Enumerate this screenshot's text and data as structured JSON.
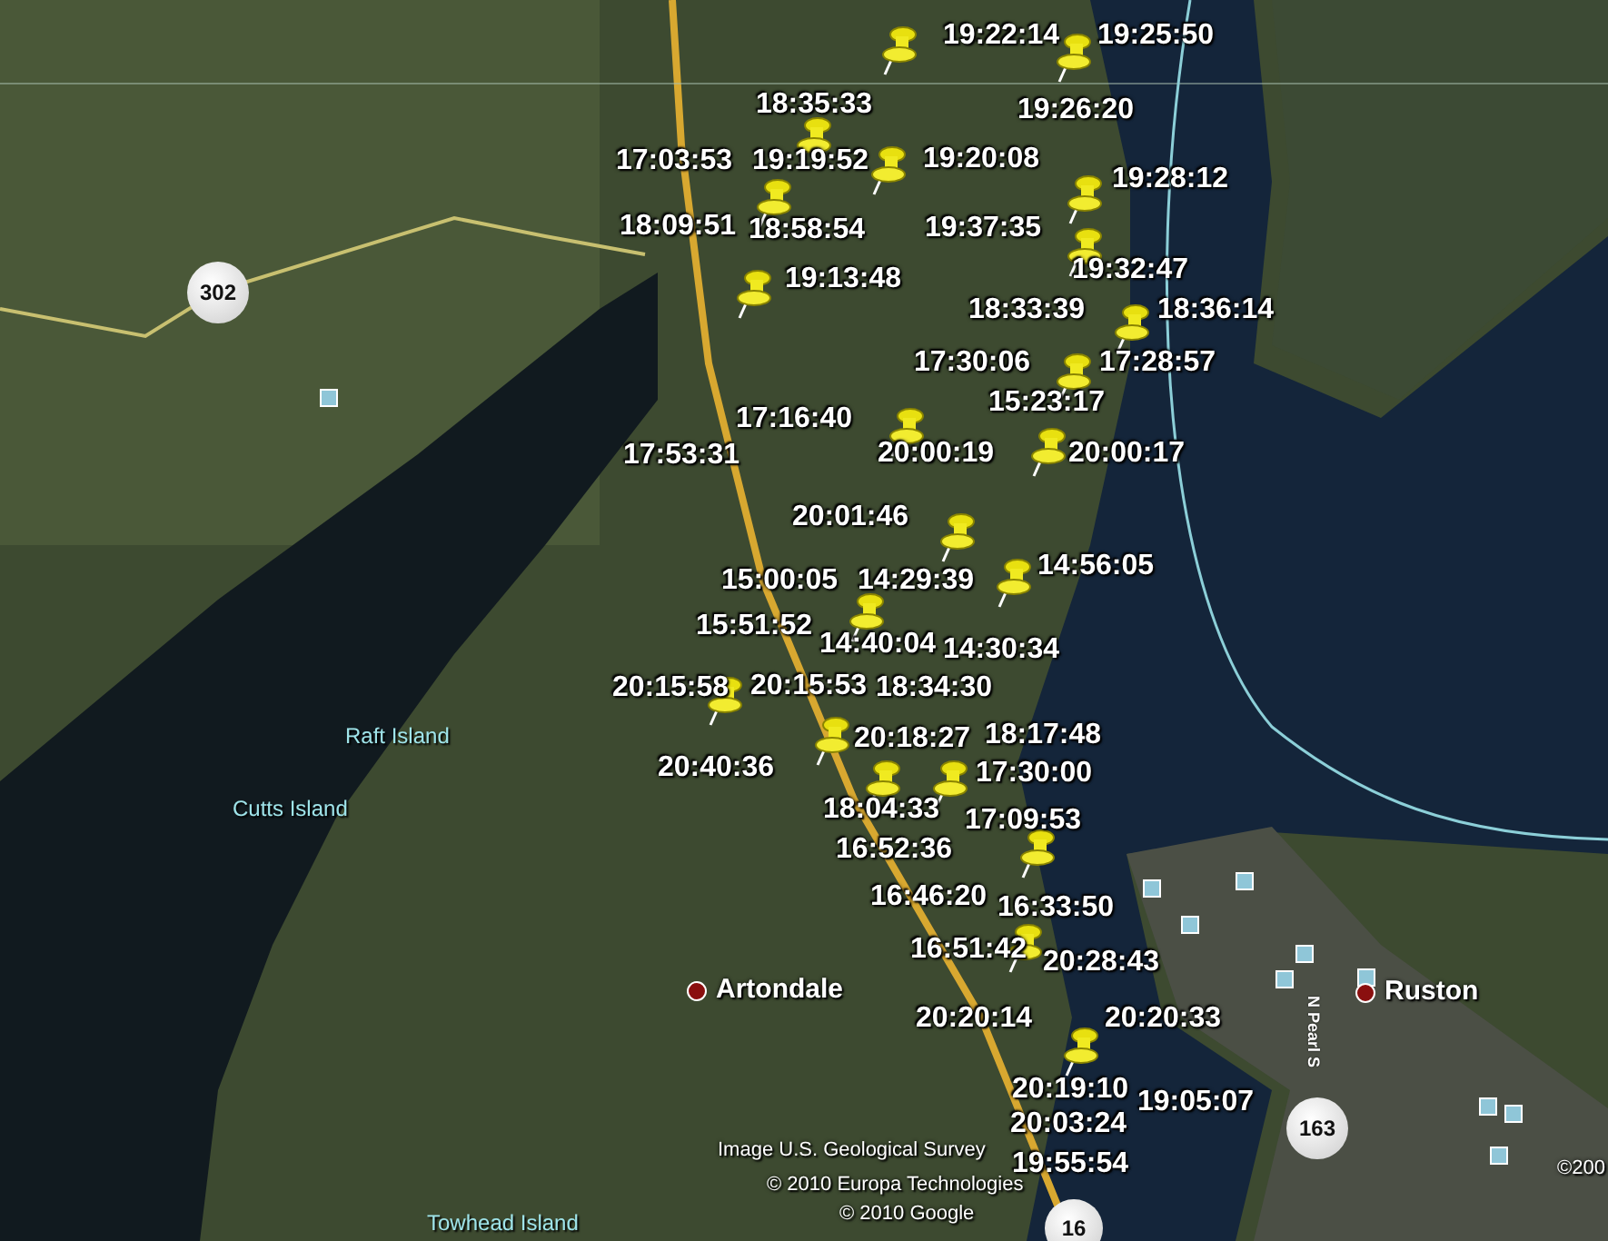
{
  "map": {
    "pin_labels": [
      "19:22:14",
      "19:25:50",
      "18:35:33",
      "19:26:20",
      "17:03:53",
      "19:19:52",
      "19:20:08",
      "19:28:12",
      "18:09:51",
      "18:58:54",
      "19:37:35",
      "19:32:47",
      "19:13:48",
      "18:33:39",
      "18:36:14",
      "17:30:06",
      "17:28:57",
      "15:23:17",
      "17:16:40",
      "17:53:31",
      "20:00:19",
      "20:00:17",
      "20:01:46",
      "14:56:05",
      "15:00:05",
      "14:29:39",
      "15:51:52",
      "14:40:04",
      "14:30:34",
      "20:15:58",
      "20:15:53",
      "18:34:30",
      "20:18:27",
      "18:17:48",
      "20:40:36",
      "17:30:00",
      "18:04:33",
      "17:09:53",
      "16:52:36",
      "16:46:20",
      "16:33:50",
      "16:51:42",
      "20:28:43",
      "20:20:14",
      "20:20:33",
      "20:19:10",
      "19:05:07",
      "20:03:24",
      "19:55:54"
    ],
    "places": [
      {
        "kind": "island",
        "name": "Raft Island"
      },
      {
        "kind": "island",
        "name": "Cutts Island"
      },
      {
        "kind": "town",
        "name": "Artondale"
      },
      {
        "kind": "town",
        "name": "Ruston"
      },
      {
        "kind": "island",
        "name": "Towhead Island"
      }
    ],
    "road_shields": [
      "302",
      "163",
      "16"
    ],
    "street_label": "N Pearl S",
    "attribution": [
      "Image U.S. Geological Survey",
      "© 2010 Europa Technologies",
      "© 2010 Google",
      "©200"
    ]
  }
}
